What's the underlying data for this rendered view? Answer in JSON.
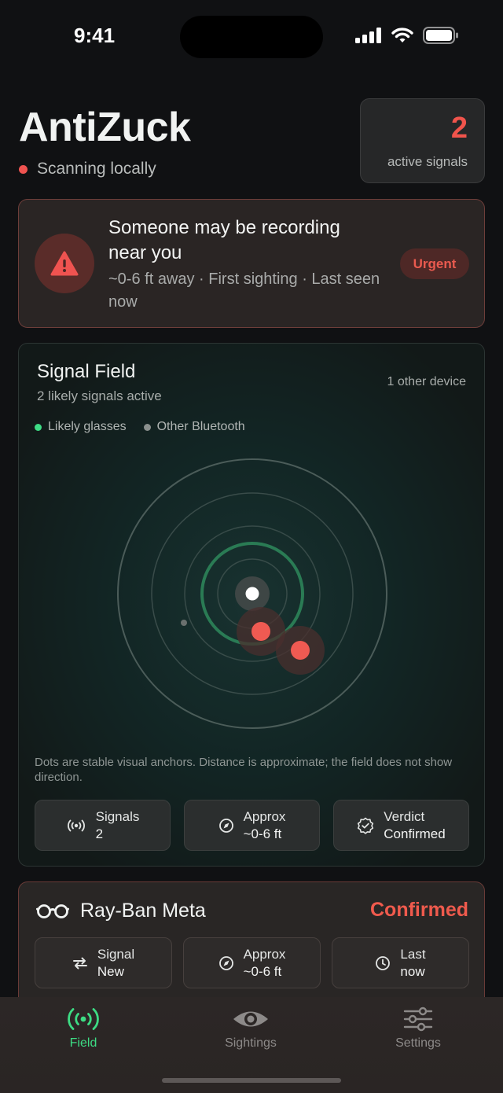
{
  "status_bar": {
    "time": "9:41",
    "icons": [
      "cellular-signal-icon",
      "wifi-icon",
      "battery-icon"
    ]
  },
  "header": {
    "title": "AntiZuck",
    "scan_status": "Scanning locally",
    "active_count": "2",
    "active_label": "active signals"
  },
  "alert": {
    "icon": "warning-triangle-icon",
    "title": "Someone may be recording near you",
    "subtitle": "~0-6 ft away · First sighting · Last seen now",
    "badge": "Urgent"
  },
  "signal_field": {
    "title": "Signal Field",
    "subtitle": "2 likely signals active",
    "other_devices": "1 other device",
    "legend": [
      {
        "label": "Likely glasses",
        "color": "#3ddc84"
      },
      {
        "label": "Other Bluetooth",
        "color": "#8a8f8d"
      }
    ],
    "note": "Dots are stable visual anchors. Distance is approximate; the field does not show direction.",
    "stats": [
      {
        "icon": "broadcast-icon",
        "label": "Signals",
        "value": "2"
      },
      {
        "icon": "compass-icon",
        "label": "Approx",
        "value": "~0-6 ft"
      },
      {
        "icon": "verified-badge-icon",
        "label": "Verdict",
        "value": "Confirmed"
      }
    ]
  },
  "device": {
    "icon": "glasses-icon",
    "name": "Ray-Ban Meta",
    "status": "Confirmed",
    "stats": [
      {
        "icon": "swap-arrows-icon",
        "label": "Signal",
        "value": "New"
      },
      {
        "icon": "compass-icon",
        "label": "Approx",
        "value": "~0-6 ft"
      },
      {
        "icon": "clock-icon",
        "label": "Last",
        "value": "now"
      }
    ]
  },
  "tabs": [
    {
      "label": "Field",
      "icon": "broadcast-icon",
      "active": true
    },
    {
      "label": "Sightings",
      "icon": "eye-icon",
      "active": false
    },
    {
      "label": "Settings",
      "icon": "sliders-icon",
      "active": false
    }
  ],
  "colors": {
    "accent_green": "#3ddc84",
    "alert_red": "#ef5350",
    "background": "#101113"
  }
}
